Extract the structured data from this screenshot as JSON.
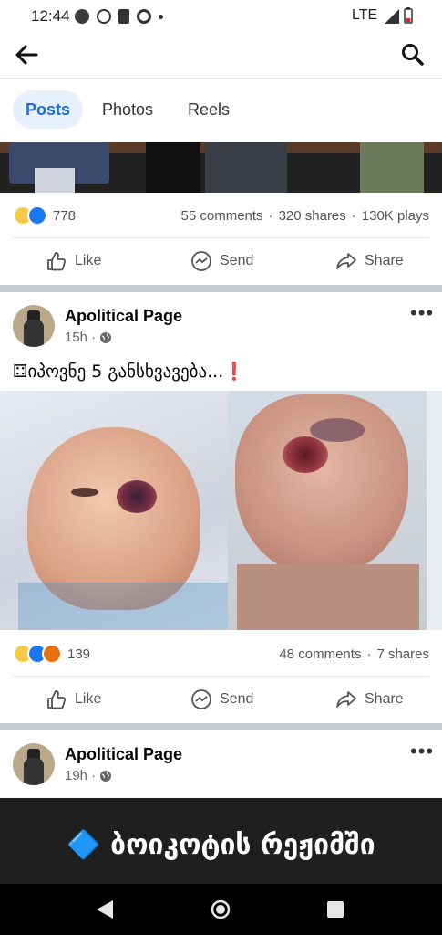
{
  "status_bar": {
    "time": "12:44",
    "network": "LTE"
  },
  "header": {
    "back_icon": "arrow-left-icon",
    "search_icon": "search-icon"
  },
  "tabs": [
    {
      "label": "Posts",
      "active": true
    },
    {
      "label": "Photos",
      "active": false
    },
    {
      "label": "Reels",
      "active": false
    }
  ],
  "post1": {
    "reaction_count": "778",
    "comments": "55 comments",
    "shares": "320 shares",
    "plays": "130K plays",
    "actions": {
      "like": "Like",
      "send": "Send",
      "share": "Share"
    }
  },
  "post2": {
    "page_name": "Apolitical Page",
    "time": "15h",
    "caption": "⚃იპოვნე 5 განსხვავება...❗",
    "reaction_count": "139",
    "comments": "48 comments",
    "shares": "7 shares",
    "actions": {
      "like": "Like",
      "send": "Send",
      "share": "Share"
    }
  },
  "post3": {
    "page_name": "Apolitical Page",
    "time": "19h",
    "banner_text": "🔷 ბოიკოტის რეჟიმში"
  },
  "colors": {
    "accent": "#1a6ed8",
    "tab_bg": "#e7f0fd"
  }
}
